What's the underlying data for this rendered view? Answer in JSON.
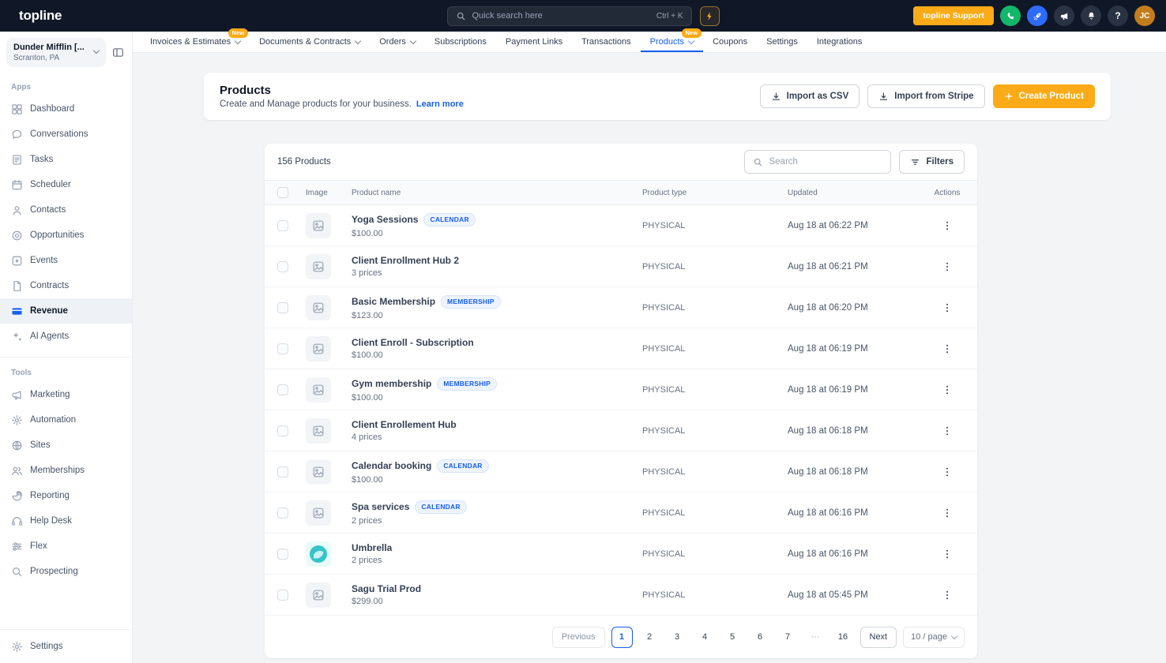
{
  "topbar": {
    "logo": "topline",
    "search_placeholder": "Quick search here",
    "search_shortcut": "Ctrl + K",
    "support_button": "topline Support",
    "avatar_initials": "JC"
  },
  "nav": {
    "tabs": [
      {
        "label": "Invoices & Estimates",
        "badge": "New"
      },
      {
        "label": "Documents & Contracts"
      },
      {
        "label": "Orders"
      },
      {
        "label": "Subscriptions"
      },
      {
        "label": "Payment Links"
      },
      {
        "label": "Transactions"
      },
      {
        "label": "Products",
        "badge": "New"
      },
      {
        "label": "Coupons"
      },
      {
        "label": "Settings"
      },
      {
        "label": "Integrations"
      }
    ]
  },
  "sidebar": {
    "account_name": "Dunder Mifflin [...",
    "account_location": "Scranton, PA",
    "apps_label": "Apps",
    "apps": [
      "Dashboard",
      "Conversations",
      "Tasks",
      "Scheduler",
      "Contacts",
      "Opportunities",
      "Events",
      "Contracts",
      "Revenue",
      "AI Agents"
    ],
    "tools_label": "Tools",
    "tools": [
      "Marketing",
      "Automation",
      "Sites",
      "Memberships",
      "Reporting",
      "Help Desk",
      "Flex",
      "Prospecting"
    ],
    "settings_label": "Settings"
  },
  "page": {
    "title": "Products",
    "subtitle": "Create and Manage products for your business.",
    "learn_more": "Learn more",
    "import_csv": "Import as CSV",
    "import_stripe": "Import from Stripe",
    "create_product": "Create Product"
  },
  "table": {
    "count": "156 Products",
    "search_placeholder": "Search",
    "filters": "Filters",
    "columns": {
      "image": "Image",
      "name": "Product name",
      "type": "Product type",
      "updated": "Updated",
      "actions": "Actions"
    },
    "rows": [
      {
        "name": "Yoga Sessions",
        "badge": "CALENDAR",
        "sub": "$100.00",
        "type": "PHYSICAL",
        "updated": "Aug 18 at 06:22 PM"
      },
      {
        "name": "Client Enrollment Hub 2",
        "sub": "3 prices",
        "type": "PHYSICAL",
        "updated": "Aug 18 at 06:21 PM"
      },
      {
        "name": "Basic Membership",
        "badge": "MEMBERSHIP",
        "sub": "$123.00",
        "type": "PHYSICAL",
        "updated": "Aug 18 at 06:20 PM"
      },
      {
        "name": "Client Enroll - Subscription",
        "sub": "$100.00",
        "type": "PHYSICAL",
        "updated": "Aug 18 at 06:19 PM"
      },
      {
        "name": "Gym membership",
        "badge": "MEMBERSHIP",
        "sub": "$100.00",
        "type": "PHYSICAL",
        "updated": "Aug 18 at 06:19 PM"
      },
      {
        "name": "Client Enrollement Hub",
        "sub": "4 prices",
        "type": "PHYSICAL",
        "updated": "Aug 18 at 06:18 PM"
      },
      {
        "name": "Calendar booking",
        "badge": "CALENDAR",
        "sub": "$100.00",
        "type": "PHYSICAL",
        "updated": "Aug 18 at 06:18 PM"
      },
      {
        "name": "Spa services",
        "badge": "CALENDAR",
        "sub": "2 prices",
        "type": "PHYSICAL",
        "updated": "Aug 18 at 06:16 PM"
      },
      {
        "name": "Umbrella",
        "sub": "2 prices",
        "type": "PHYSICAL",
        "updated": "Aug 18 at 06:16 PM"
      },
      {
        "name": "Sagu Trial Prod",
        "sub": "$299.00",
        "type": "PHYSICAL",
        "updated": "Aug 18 at 05:45 PM"
      }
    ],
    "pagination": {
      "previous": "Previous",
      "pages": [
        "1",
        "2",
        "3",
        "4",
        "5",
        "6",
        "7",
        "···",
        "16"
      ],
      "next": "Next",
      "page_size": "10 / page"
    }
  },
  "colors": {
    "accent_blue": "#155eef",
    "brand_yellow": "#fbab17",
    "topbar_bg": "#101828",
    "badge_bg": "#eef4ff"
  }
}
